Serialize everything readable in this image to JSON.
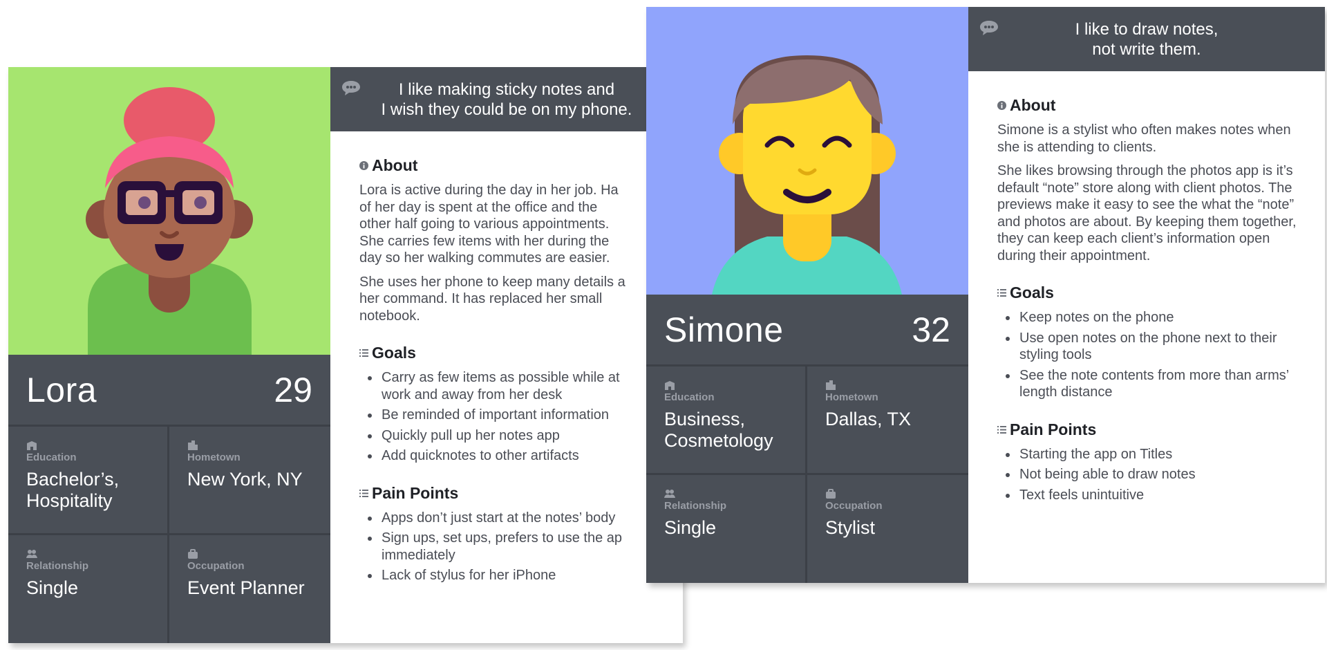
{
  "personas": {
    "lora": {
      "name": "Lora",
      "age": "29",
      "quote": "I like making sticky notes and\nI wish they could be on my phone.",
      "stats": {
        "education": {
          "label": "Education",
          "value": "Bachelor’s,\nHospitality"
        },
        "hometown": {
          "label": "Hometown",
          "value": "New York, NY"
        },
        "relationship": {
          "label": "Relationship",
          "value": "Single"
        },
        "occupation": {
          "label": "Occupation",
          "value": "Event Planner"
        }
      },
      "about": {
        "title": "About",
        "paragraphs": [
          "Lora is active during the day in her job. Ha\nof her day is spent at the office and the\nother half going to various appointments.\nShe carries few items with her during the\nday so her walking commutes are easier.",
          "She uses her phone to keep many details a\nher command. It has replaced her small\nnotebook."
        ]
      },
      "goals": {
        "title": "Goals",
        "items": [
          "Carry as few items as possible while at\nwork and away from her desk",
          "Be reminded of important information",
          "Quickly pull up her notes app",
          "Add quicknotes to other artifacts"
        ]
      },
      "pain_points": {
        "title": "Pain Points",
        "items": [
          "Apps don’t just start at the notes’ body",
          "Sign ups, set ups, prefers to use the ap\nimmediately",
          "Lack of stylus for her iPhone"
        ]
      },
      "colors": {
        "photo_bg": "#a6e56f",
        "shirt": "#6cbf4e",
        "hair": "#e85a6a",
        "skin": "#a8674f"
      }
    },
    "simone": {
      "name": "Simone",
      "age": "32",
      "quote": "I like to draw notes,\nnot write them.",
      "stats": {
        "education": {
          "label": "Education",
          "value": "Business,\nCosmetology"
        },
        "hometown": {
          "label": "Hometown",
          "value": "Dallas, TX"
        },
        "relationship": {
          "label": "Relationship",
          "value": "Single"
        },
        "occupation": {
          "label": "Occupation",
          "value": "Stylist"
        }
      },
      "about": {
        "title": "About",
        "paragraphs": [
          "Simone is a stylist who often makes notes when she is attending to clients.",
          "She likes browsing through the photos app is it’s default “note” store along with client photos. The previews make it easy to see the what the “note” and photos are about. By keeping them together, they can keep each client’s information open during their appointment."
        ]
      },
      "goals": {
        "title": "Goals",
        "items": [
          "Keep notes on the phone",
          "Use open notes on the phone next to their styling tools",
          "See the note contents from more than arms’ length distance"
        ]
      },
      "pain_points": {
        "title": "Pain Points",
        "items": [
          "Starting the app on Titles",
          "Not being able to draw notes",
          "Text feels unintuitive"
        ]
      },
      "colors": {
        "photo_bg": "#90a4fc",
        "shirt": "#53d6c2",
        "hair": "#8d6e6e",
        "skin": "#ffd92f"
      }
    }
  },
  "icons": {
    "quote": "chat-bubble-icon",
    "about": "info-icon",
    "goals": "list-icon",
    "pain_points": "list-icon",
    "education": "school-icon",
    "hometown": "city-icon",
    "relationship": "people-icon",
    "occupation": "briefcase-icon"
  },
  "theme": {
    "panel": "#4a4f57",
    "divider": "#3c4047",
    "label": "#9a9ea6"
  }
}
